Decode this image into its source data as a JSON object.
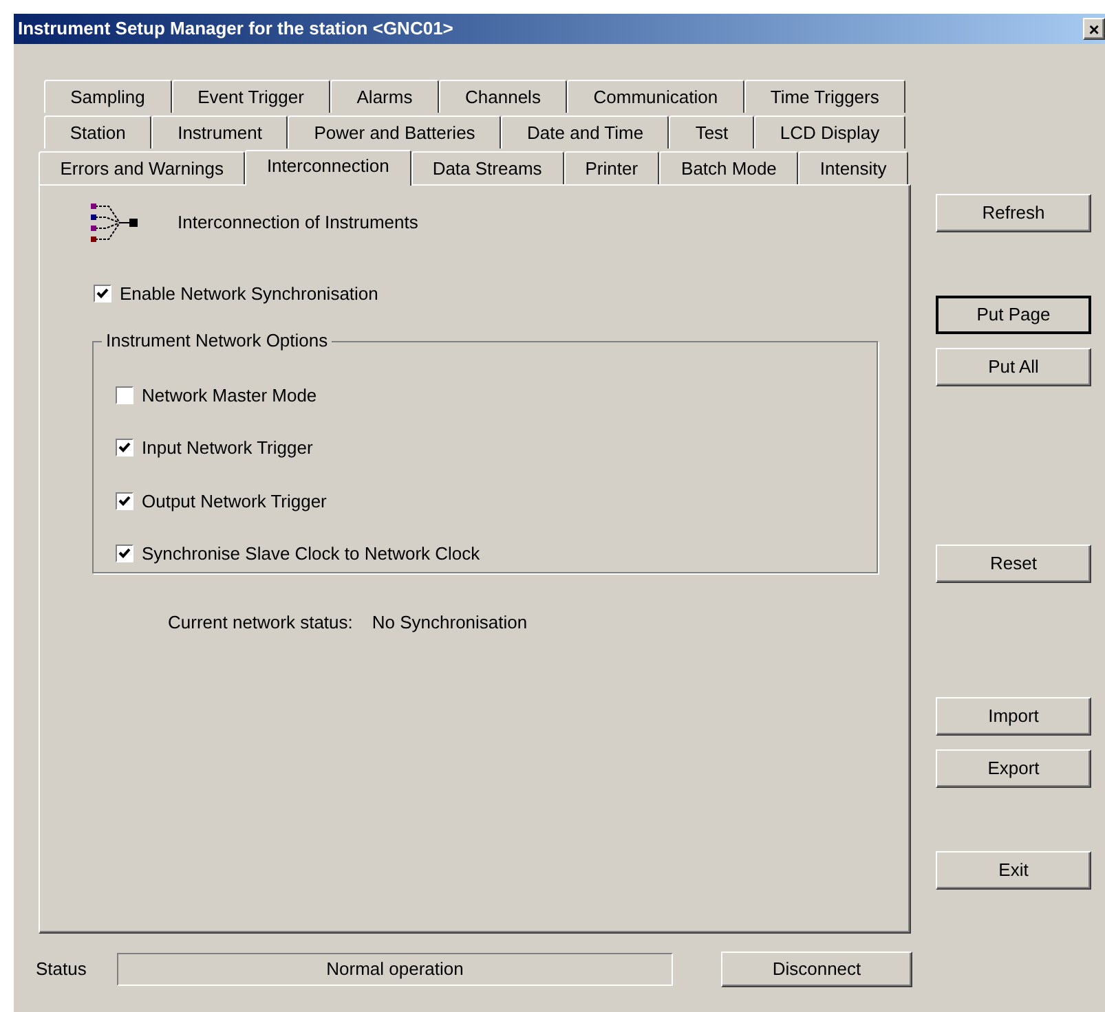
{
  "window": {
    "title": "Instrument Setup Manager for the station <GNC01>",
    "close": "×"
  },
  "tab_rows": [
    [
      {
        "label": "Sampling",
        "selected": false
      },
      {
        "label": "Event Trigger",
        "selected": false
      },
      {
        "label": "Alarms",
        "selected": false
      },
      {
        "label": "Channels",
        "selected": false
      },
      {
        "label": "Communication",
        "selected": false
      },
      {
        "label": "Time Triggers",
        "selected": false
      }
    ],
    [
      {
        "label": "Station",
        "selected": false
      },
      {
        "label": "Instrument",
        "selected": false
      },
      {
        "label": "Power and Batteries",
        "selected": false
      },
      {
        "label": "Date and Time",
        "selected": false
      },
      {
        "label": "Test",
        "selected": false
      },
      {
        "label": "LCD Display",
        "selected": false
      }
    ],
    [
      {
        "label": "Errors and Warnings",
        "selected": false
      },
      {
        "label": "Interconnection",
        "selected": true
      },
      {
        "label": "Data Streams",
        "selected": false
      },
      {
        "label": "Printer",
        "selected": false
      },
      {
        "label": "Batch Mode",
        "selected": false
      },
      {
        "label": "Intensity",
        "selected": false
      }
    ]
  ],
  "page": {
    "heading": "Interconnection of Instruments",
    "enable": {
      "label": "Enable Network Synchronisation",
      "checked": true
    },
    "group": {
      "title": "Instrument Network Options",
      "options": [
        {
          "label": "Network Master Mode",
          "checked": false
        },
        {
          "label": "Input Network Trigger",
          "checked": true
        },
        {
          "label": "Output Network Trigger",
          "checked": true
        },
        {
          "label": "Synchronise Slave Clock to Network Clock",
          "checked": true
        }
      ]
    },
    "status_label": "Current network status:",
    "status_value": "No Synchronisation"
  },
  "buttons": [
    {
      "label": "Refresh",
      "default": false
    },
    {
      "label": "Put Page",
      "default": true
    },
    {
      "label": "Put All",
      "default": false
    },
    {
      "label": "Reset",
      "default": false
    },
    {
      "label": "Import",
      "default": false
    },
    {
      "label": "Export",
      "default": false
    },
    {
      "label": "Exit",
      "default": false
    }
  ],
  "status_bar": {
    "label": "Status",
    "value": "Normal operation",
    "button": "Disconnect"
  }
}
